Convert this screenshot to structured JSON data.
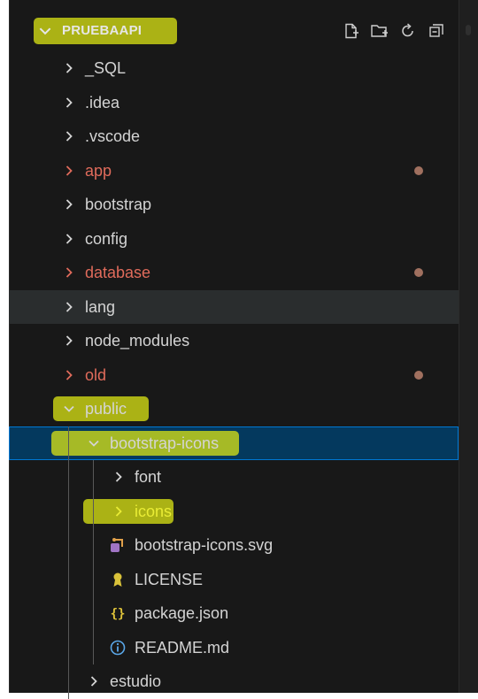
{
  "explorer": {
    "title": "PRUEBAAPI",
    "actions": [
      {
        "name": "new-file-icon"
      },
      {
        "name": "new-folder-icon"
      },
      {
        "name": "refresh-icon"
      },
      {
        "name": "collapse-all-icon"
      }
    ]
  },
  "tree": [
    {
      "label": "_SQL",
      "kind": "folder",
      "expanded": false,
      "depth": 1,
      "status": "normal"
    },
    {
      "label": ".idea",
      "kind": "folder",
      "expanded": false,
      "depth": 1,
      "status": "normal"
    },
    {
      "label": ".vscode",
      "kind": "folder",
      "expanded": false,
      "depth": 1,
      "status": "normal"
    },
    {
      "label": "app",
      "kind": "folder",
      "expanded": false,
      "depth": 1,
      "status": "modified"
    },
    {
      "label": "bootstrap",
      "kind": "folder",
      "expanded": false,
      "depth": 1,
      "status": "normal"
    },
    {
      "label": "config",
      "kind": "folder",
      "expanded": false,
      "depth": 1,
      "status": "normal"
    },
    {
      "label": "database",
      "kind": "folder",
      "expanded": false,
      "depth": 1,
      "status": "modified"
    },
    {
      "label": "lang",
      "kind": "folder",
      "expanded": false,
      "depth": 1,
      "status": "normal",
      "hover": true
    },
    {
      "label": "node_modules",
      "kind": "folder",
      "expanded": false,
      "depth": 1,
      "status": "normal"
    },
    {
      "label": "old",
      "kind": "folder",
      "expanded": false,
      "depth": 1,
      "status": "modified"
    },
    {
      "label": "public",
      "kind": "folder",
      "expanded": true,
      "depth": 1,
      "status": "normal"
    },
    {
      "label": "bootstrap-icons",
      "kind": "folder",
      "expanded": true,
      "depth": 2,
      "status": "normal",
      "selected": true
    },
    {
      "label": "font",
      "kind": "folder",
      "expanded": false,
      "depth": 3,
      "status": "normal"
    },
    {
      "label": "icons",
      "kind": "folder",
      "expanded": false,
      "depth": 3,
      "status": "normal"
    },
    {
      "label": "bootstrap-icons.svg",
      "kind": "file",
      "icon": "svg-file-icon",
      "depth": 3,
      "status": "normal"
    },
    {
      "label": "LICENSE",
      "kind": "file",
      "icon": "license-icon",
      "depth": 3,
      "status": "normal"
    },
    {
      "label": "package.json",
      "kind": "file",
      "icon": "json-braces-icon",
      "depth": 3,
      "status": "normal"
    },
    {
      "label": "README.md",
      "kind": "file",
      "icon": "info-icon",
      "depth": 3,
      "status": "normal"
    },
    {
      "label": "estudio",
      "kind": "folder",
      "expanded": false,
      "depth": 2,
      "status": "normal"
    }
  ],
  "colors": {
    "background": "#181818",
    "text": "#d4d4d4",
    "modified": "#e06b5b",
    "modified_dot": "#a0705f",
    "selection": "#04395e",
    "selection_border": "#0078d4",
    "highlighter": "#dce614"
  }
}
